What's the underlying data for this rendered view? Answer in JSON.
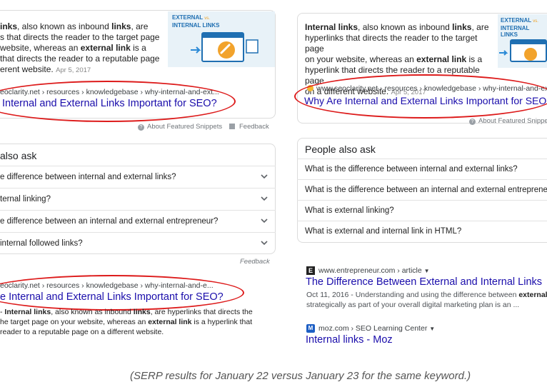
{
  "left": {
    "featured": {
      "snippet_lines": [
        "links, also known as inbound links, are",
        "s that directs the reader to the target page",
        "website, whereas an external link is a",
        "that directs the reader to a reputable page"
      ],
      "snippet_last": "erent website.",
      "date": "Apr 5, 2017",
      "thumb_title_1": "EXTERNAL",
      "thumb_vs": "vs.",
      "thumb_title_2": "INTERNAL LINKS",
      "breadcrumb": "eoclarity.net › resources › knowledgebase › why-internal-and-ext...",
      "title": "Internal and External Links Important for SEO?",
      "about": "About Featured Snippets",
      "feedback": "Feedback"
    },
    "paa": {
      "heading": "also ask",
      "questions": [
        "e difference between internal and external links?",
        "ternal linking?",
        "e difference between an internal and external entrepreneur?",
        "internal followed links?"
      ],
      "feedback": "Feedback"
    },
    "result": {
      "breadcrumb": "eoclarity.net › resources › knowledgebase › why-internal-and-e...",
      "title": "e Internal and External Links Important for SEO?",
      "snippet_lines": [
        "- Internal links, also known as inbound links, are hyperlinks that directs the",
        "he target page on your website, whereas an external link is a hyperlink that",
        "reader to a reputable page on a different website."
      ]
    }
  },
  "right": {
    "featured": {
      "snippet_lines": [
        "Internal links, also known as inbound links, are",
        "hyperlinks that directs the reader to the target page",
        "on your website, whereas an external link is a",
        "hyperlink that directs the reader to a reputable page"
      ],
      "snippet_last": "on a different website.",
      "date": "Apr 5, 2017",
      "thumb_title_1": "EXTERNAL",
      "thumb_vs": "vs.",
      "thumb_title_2": "INTERNAL LINKS",
      "breadcrumb": "www.seoclarity.net › resources › knowledgebase › why-internal-and-ext...",
      "title": "Why Are Internal and External Links Important for SEO?",
      "about": "About Featured Snippets"
    },
    "paa": {
      "heading": "People also ask",
      "questions": [
        "What is the difference between internal and external links?",
        "What is the difference between an internal and external entrepreneur",
        "What is external linking?",
        "What is external and internal link in HTML?"
      ]
    },
    "result1": {
      "favicon": "E",
      "breadcrumb": "www.entrepreneur.com › article",
      "title": "The Difference Between External and Internal Links",
      "date": "Oct 11, 2016",
      "snippet_1": " - Understanding and using the difference between external and in",
      "snippet_2": "strategically as part of your overall digital marketing plan is an ..."
    },
    "result2": {
      "favicon": "M",
      "breadcrumb": "moz.com › SEO Learning Center",
      "title": "Internal links - Moz"
    }
  },
  "caption": "(SERP results for January 22 versus January 23 for the same keyword.)",
  "colors": {
    "oval": "#dd1b1b",
    "link": "#1a0dab"
  }
}
